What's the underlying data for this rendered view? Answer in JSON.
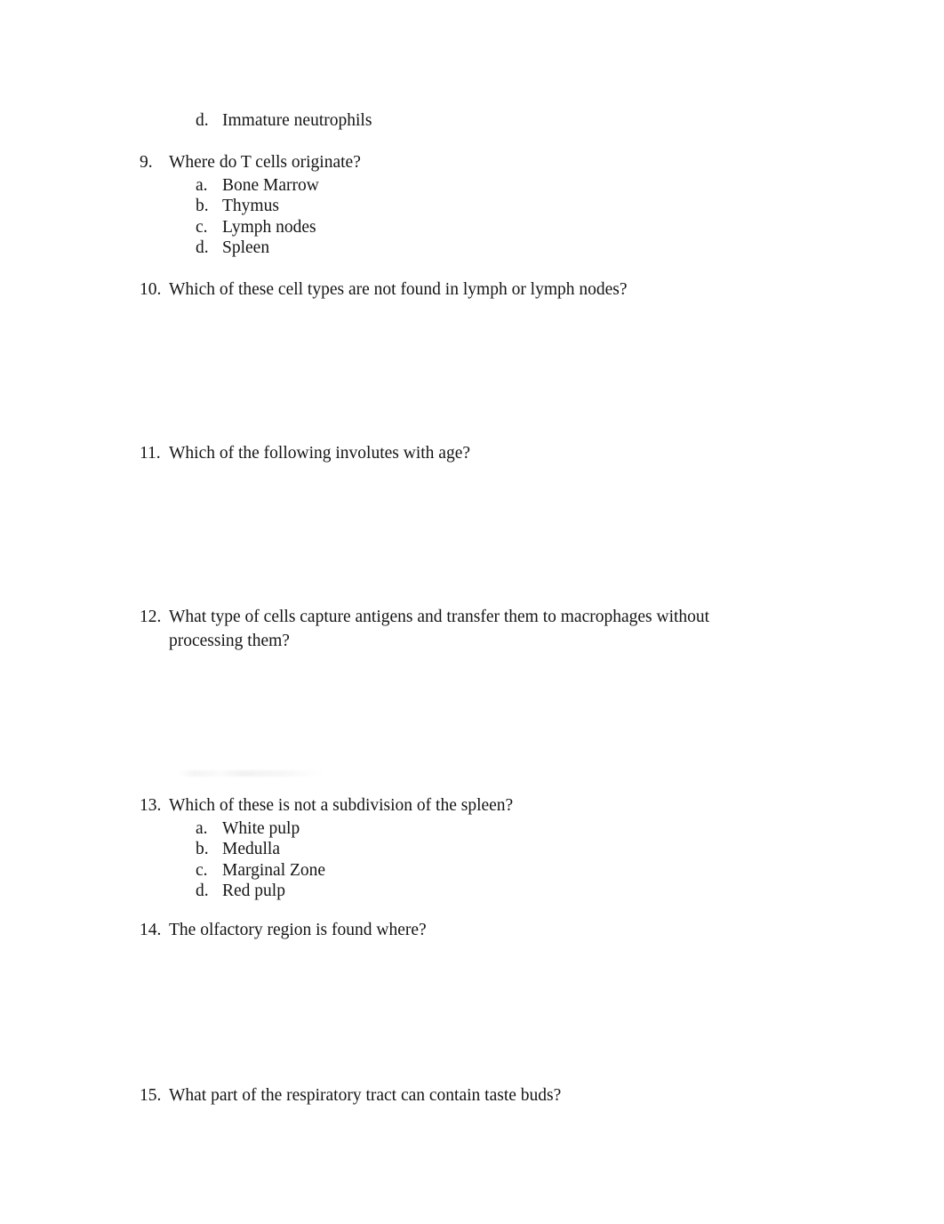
{
  "document": {
    "type": "multiple-choice exam worksheet",
    "background_color": "#ffffff",
    "text_color": "#151515"
  },
  "orphan_option": {
    "letter": "d.",
    "text": "Immature neutrophils"
  },
  "questions": [
    {
      "number": "9.",
      "text": "Where do T cells originate?",
      "options": [
        {
          "letter": "a.",
          "text": "Bone Marrow"
        },
        {
          "letter": "b.",
          "text": "Thymus"
        },
        {
          "letter": "c.",
          "text": "Lymph nodes"
        },
        {
          "letter": "d.",
          "text": "Spleen"
        }
      ]
    },
    {
      "number": "10.",
      "text": "Which of these cell types are not found in lymph or lymph nodes?",
      "options": []
    },
    {
      "number": "11.",
      "text": "Which of the following involutes with age?",
      "options": []
    },
    {
      "number": "12.",
      "text": "What type of cells capture antigens and transfer them to macrophages without processing them?",
      "options": []
    },
    {
      "number": "13.",
      "text": "Which of these is not a subdivision of the spleen?",
      "options": [
        {
          "letter": "a.",
          "text": "White pulp"
        },
        {
          "letter": "b.",
          "text": "Medulla"
        },
        {
          "letter": "c.",
          "text": "Marginal Zone"
        },
        {
          "letter": "d.",
          "text": "Red pulp"
        }
      ]
    },
    {
      "number": "14.",
      "text": "The olfactory region is found where?",
      "options": []
    },
    {
      "number": "15.",
      "text": "What part of the respiratory tract can contain taste buds?",
      "options": []
    }
  ]
}
